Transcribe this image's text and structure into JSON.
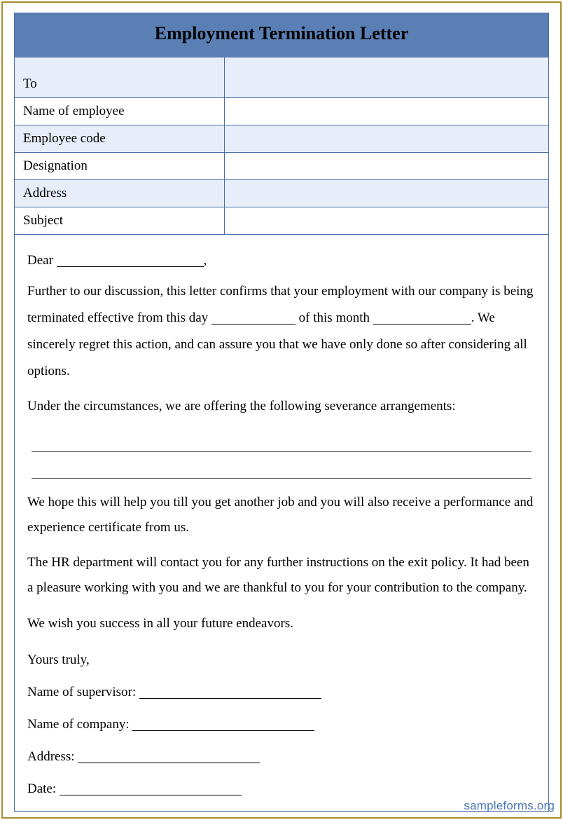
{
  "title": "Employment Termination Letter",
  "fields": {
    "to": "To",
    "name": "Name of employee",
    "code": "Employee code",
    "designation": "Designation",
    "address": "Address",
    "subject": "Subject"
  },
  "body": {
    "dear": "Dear",
    "dear_comma": ",",
    "p1a": "Further to our discussion, this letter confirms that your employment with our company is being terminated effective from this day",
    "p1b": "of this month",
    "p1c": ". We sincerely regret this action, and can assure you that we have only done so after considering all options.",
    "p2": "Under the circumstances, we are offering the following severance arrangements:",
    "p3": "We hope this will help you till you get another job and you will also receive a performance and experience certificate from us.",
    "p4": "The HR department will contact you for any further instructions on the exit policy. It had been a pleasure working with you and we are thankful to you for your contribution to the company.",
    "p5": "We wish you success in all your future endeavors.",
    "closing": "Yours truly,",
    "supervisor": "Name of supervisor:",
    "company": "Name of company:",
    "addr": "Address:",
    "date": "Date:"
  },
  "watermark": "sampleforms.org"
}
